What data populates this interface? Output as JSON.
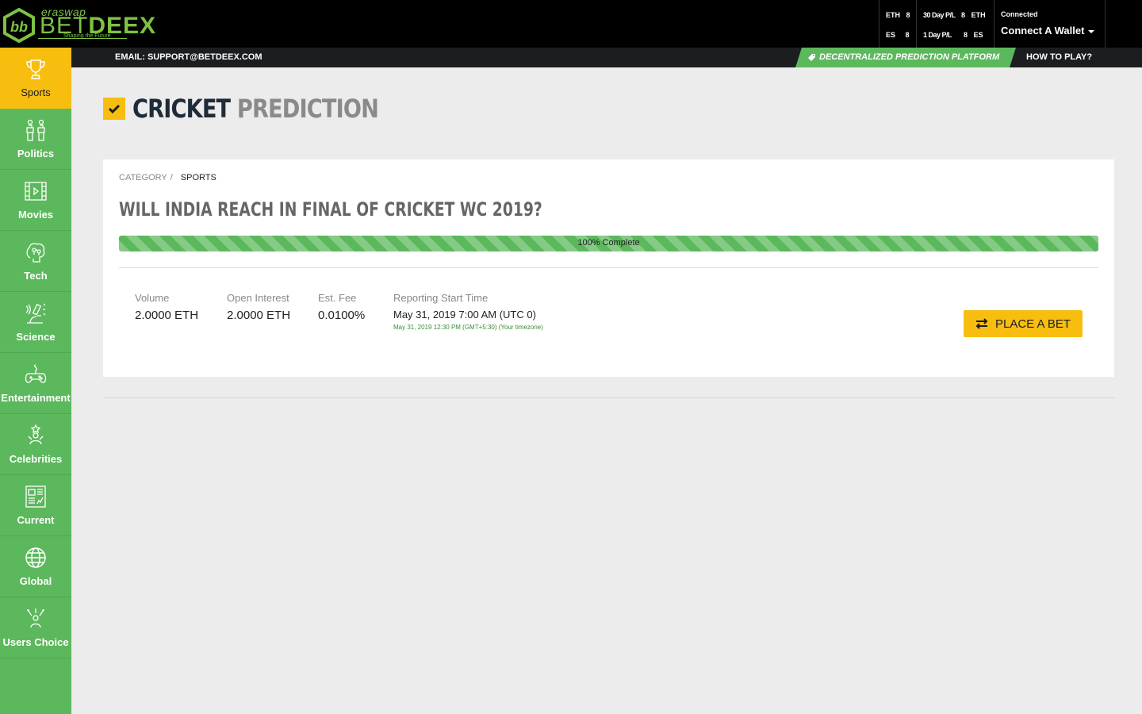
{
  "brand": {
    "top": "era",
    "top_accent": "swap",
    "name_a": "BET",
    "name_b": "DEEX",
    "tagline": "Shaping the Future"
  },
  "header_stats": {
    "col1": [
      {
        "label": "ETH",
        "value": "8"
      },
      {
        "label": "ES",
        "value": "8"
      }
    ],
    "col2": [
      {
        "label": "30 Day P/L",
        "value": "8",
        "unit": "ETH"
      },
      {
        "label": "1 Day P/L",
        "value": "8",
        "unit": "ES"
      }
    ]
  },
  "wallet": {
    "status": "Connected",
    "button": "Connect A Wallet"
  },
  "subbar": {
    "email": "EMAIL: SUPPORT@BETDEEX.COM",
    "platform": "DECENTRALIZED PREDICTION PLATFORM",
    "howto": "HOW TO PLAY?"
  },
  "sidebar": {
    "items": [
      {
        "label": "Sports",
        "icon": "trophy-icon",
        "active": true
      },
      {
        "label": "Politics",
        "icon": "politics-icon"
      },
      {
        "label": "Movies",
        "icon": "film-icon"
      },
      {
        "label": "Tech",
        "icon": "tech-brain-icon"
      },
      {
        "label": "Science",
        "icon": "microscope-icon"
      },
      {
        "label": "Entertainment",
        "icon": "gamepad-icon"
      },
      {
        "label": "Celebrities",
        "icon": "celebrity-icon"
      },
      {
        "label": "Current",
        "icon": "newspaper-icon"
      },
      {
        "label": "Global",
        "icon": "globe-icon"
      },
      {
        "label": "Users Choice",
        "icon": "users-choice-icon"
      }
    ]
  },
  "page": {
    "title_a": "CRICKET",
    "title_b": "PREDICTION"
  },
  "card": {
    "crumb_label": "CATEGORY",
    "crumb_sep": "/",
    "crumb_current": "SPORTS",
    "question": "WILL INDIA REACH IN FINAL OF CRICKET WC 2019?",
    "progress_pct": 100,
    "progress_label": "100% Complete",
    "stats": {
      "volume_label": "Volume",
      "volume_value": "2.0000 ETH",
      "oi_label": "Open Interest",
      "oi_value": "2.0000 ETH",
      "fee_label": "Est. Fee",
      "fee_value": "0.0100%",
      "report_label": "Reporting Start Time",
      "report_value": "May 31, 2019 7:00 AM (UTC 0)",
      "report_local": "May 31, 2019 12:30 PM (GMT+5:30) (Your timezone)"
    },
    "bet_button": "PLACE A BET"
  },
  "colors": {
    "green": "#5cb85c",
    "yellow": "#f7be10",
    "dark": "#1b1d21"
  }
}
